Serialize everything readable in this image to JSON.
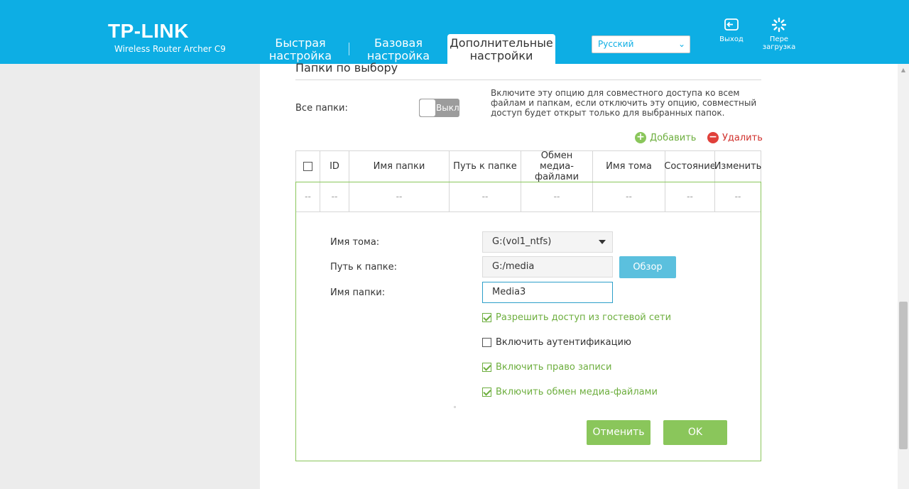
{
  "header": {
    "brand": "TP-LINK",
    "model": "Wireless Router Archer C9",
    "tabs": [
      {
        "label_line1": "Быстрая",
        "label_line2": "настройка"
      },
      {
        "label_line1": "Базовая",
        "label_line2": "настройка"
      },
      {
        "label_line1": "Дополнительные",
        "label_line2": "настройки"
      }
    ],
    "active_tab": 2,
    "language": "Русский",
    "logout_label": "Выход",
    "reboot_label_line1": "Пере",
    "reboot_label_line2": "загрузка",
    "accent_color": "#0daee4"
  },
  "section": {
    "title": "Папки по выбору",
    "all_folders_label": "Все папки:",
    "toggle_state": "Выкл",
    "hint": "Включите эту опцию для совместного доступа ко всем файлам и папкам, если отключить эту опцию, совместный доступ будет открыт только для выбранных папок.",
    "add_label": "Добавить",
    "delete_label": "Удалить"
  },
  "table": {
    "columns": [
      "ID",
      "Имя папки",
      "Путь к папке",
      "Обмен медиа-файлами",
      "Имя тома",
      "Состояние",
      "Изменить"
    ],
    "row": [
      "--",
      "--",
      "--",
      "--",
      "--",
      "--",
      "--",
      "--"
    ]
  },
  "form": {
    "volume_label": "Имя тома:",
    "volume_value": "G:(vol1_ntfs)",
    "path_label": "Путь к папке:",
    "path_value": "G:/media",
    "browse_label": "Обзор",
    "name_label": "Имя папки:",
    "name_value": "Media3",
    "options": [
      {
        "label": "Разрешить доступ из гостевой сети",
        "checked": true
      },
      {
        "label": "Включить аутентификацию",
        "checked": false
      },
      {
        "label": "Включить право записи",
        "checked": true
      },
      {
        "label": "Включить обмен медиа-файлами",
        "checked": true
      }
    ],
    "cancel_label": "Отменить",
    "ok_label": "OK",
    "green_color": "#8ac65b"
  }
}
